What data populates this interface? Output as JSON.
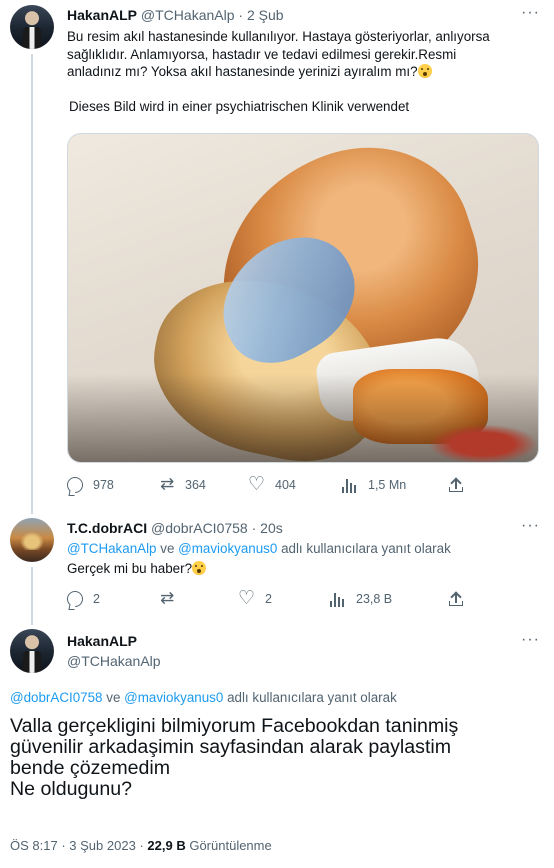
{
  "tweet1": {
    "name": "HakanALP",
    "handle": "@TCHakanAlp",
    "sep": "·",
    "time": "2 Şub",
    "text_line1": "Bu resim akıl hastanesinde kullanılıyor. Hastaya gösteriyorlar, anlıyorsa",
    "text_line2": "sağlıklıdır. Anlamıyorsa, hastadır ve tedavi edilmesi gerekir.Resmi",
    "text_line3": "anladınız mı? Yoksa akıl hastanesinde yerinizi ayıralım mı?",
    "text_line4": "Dieses Bild wird in einer psychiatrischen Klinik verwendet",
    "replies": "978",
    "retweets": "364",
    "likes": "404",
    "views": "1,5 Mn"
  },
  "tweet2": {
    "name": "T.C.dobrACI",
    "handle": "@dobrACI0758",
    "sep": "·",
    "time": "20s",
    "mention1": "@TCHakanAlp",
    "mention_and": "ve",
    "mention2": "@maviokyanus0",
    "mention_suffix": "adlı kullanıcılara yanıt olarak",
    "text": "Gerçek mi bu haber?",
    "replies": "2",
    "retweets": "",
    "likes": "2",
    "views": "23,8 B"
  },
  "tweet3": {
    "name": "HakanALP",
    "handle": "@TCHakanAlp",
    "mention1": "@dobrACI0758",
    "mention_and": "ve",
    "mention2": "@maviokyanus0",
    "mention_suffix": "adlı kullanıcılara yanıt olarak",
    "text_line1": "Valla gerçekligini bilmiyorum Facebookdan taninmiş",
    "text_line2": "güvenilir arkadaşimin sayfasindan alarak paylastim",
    "text_line3": "bende çözemedim",
    "text_line4": "Ne oldugunu?",
    "time": "ÖS 8:17",
    "sep": "·",
    "date": "3 Şub 2023",
    "views_count": "22,9 B",
    "views_label": "Görüntülenme"
  },
  "icons": {
    "more": "more-horizontal-icon",
    "reply": "reply-icon",
    "retweet": "retweet-icon",
    "like": "heart-icon",
    "views": "views-icon",
    "share": "share-icon"
  },
  "colors": {
    "text": "#0f1419",
    "muted": "#536471",
    "link": "#1d9bf0",
    "border": "#cfd9de"
  }
}
